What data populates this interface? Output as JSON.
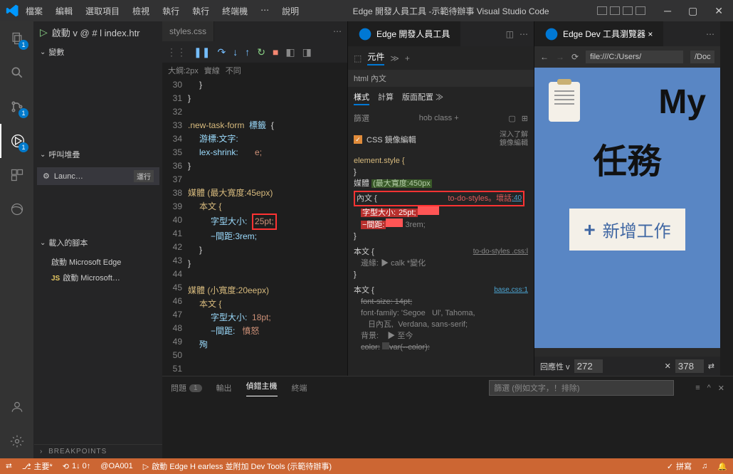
{
  "titlebar": {
    "menu": [
      "檔案",
      "編輯",
      "選取項目",
      "檢視",
      "執行",
      "執行",
      "終端機",
      "⋯",
      "說明"
    ],
    "title": "Edge 開發人員工具 -示範待辦事 Visual Studio Code"
  },
  "sidebar": {
    "debug_label": "啟動 v @ # l index.htr",
    "variables_hdr": "變數",
    "callstack_hdr": "呼叫堆疊",
    "launch_name": "Launc…",
    "launch_badge": "運行",
    "scripts_hdr": "載入的腳本",
    "script1": "啟動 Microsoft Edge",
    "script2": "啟動 Microsoft…",
    "breakpoints_hdr": "BREAKPOINTS"
  },
  "editor": {
    "tab1": "styles.css",
    "bc_outline": "大綱:2px",
    "bc_solid": "實線",
    "bc_diff": "不同",
    "gutter": [
      "30",
      "31",
      "32",
      "33",
      "34",
      "35",
      "36",
      "37",
      "38",
      "39",
      "40",
      "41",
      "42",
      "43",
      "44",
      "45",
      "46",
      "47",
      "48",
      "49",
      "50",
      "51"
    ],
    "code_l33": ".new-task-form",
    "code_l33b": "標籤",
    "code_l34": "游標:文字:",
    "code_l35": "lex-shrink:",
    "code_l35b": "e;",
    "code_l39": "媒體 (最大寬度:45epx)",
    "code_l40": "本文 {",
    "code_l41a": "字型大小:",
    "code_l41b": "25pt;",
    "code_l42": "−間距:3rem;",
    "code_l46": "媒體 (小寬度:20eepx)",
    "code_l47": "本文 {",
    "code_l48a": "字型大小:",
    "code_l48b": "18pt;",
    "code_l49a": "−間距:",
    "code_l49b": "憤怒",
    "code_l50": "殉"
  },
  "devtools": {
    "tab_title": "Edge 開發人員工具",
    "elements_tab": "元件",
    "html_body": "html 內文",
    "styles_tab": "様式",
    "computed_tab": "計算",
    "layout_tab": "版面配置 ≫",
    "filter_label": "篩選",
    "hov": "hob class +",
    "mirror_label": "CSS 鏡像編輯",
    "mirror_link1": "深入了解",
    "mirror_link2": "鏡像編輯",
    "element_style": "element.style {",
    "media_label": "媒體",
    "media_query": "(最大寬度:450px",
    "body_label": "內文",
    "css_file": "to-do-styles。壞話",
    "css_line": ":40",
    "font_size_prop": "字型大小:",
    "font_size_val": "25pt;",
    "spacing_prop": "−間距:",
    "spacing_val": "3rem;",
    "body2": "本文 {",
    "css_file2": "to-do-styles .css:l",
    "inherit": "邊緣:",
    "calc": "▶ calk *變化",
    "body3": "本文 {",
    "base_link": "base.css:1",
    "struck1": "font-size: 14pt;",
    "font_family": "font-family: 'Segoe",
    "font_family2": "Ul', Tahoma,",
    "font_family3": "日內瓦,",
    "font_family4": "Verdana, sans-serif;",
    "bg": "背景:",
    "bg_val": "▶ 至今",
    "color": "color:",
    "color_val": "var(--color):"
  },
  "browser": {
    "tab_title": "Edge Dev 工具瀏覽器 ×",
    "url_prefix": "file:///C:/Users/",
    "url_suffix": "/Doc",
    "my_text": "My",
    "task_text": "任務",
    "add_task": "新增工作",
    "responsive": "回應性 v",
    "width": "272",
    "height": "378"
  },
  "panel": {
    "problems": "問題",
    "count": "1",
    "output": "輸出",
    "debug_console": "偵錯主機",
    "terminal": "終端",
    "filter_placeholder": "篩選 (例如文字，！排除)"
  },
  "status": {
    "branch": "主要*",
    "sync": "1↓ 0↑",
    "user": "@OA001",
    "task": "啟動 Edge H earless 並附加 Dev Tools (示範待辦事)",
    "spell": "拼寫",
    "bell": "♫"
  },
  "chart_data": null
}
